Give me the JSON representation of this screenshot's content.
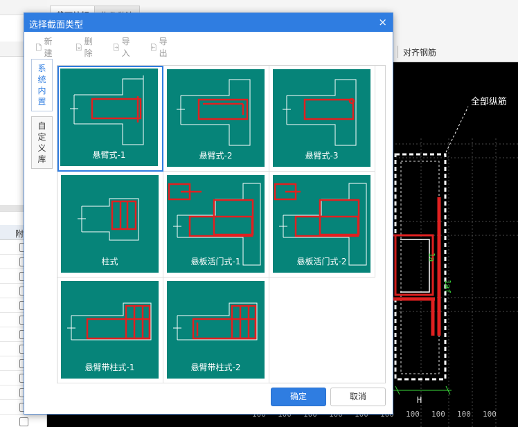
{
  "background": {
    "tabs": [
      "截面编辑",
      "构件做法"
    ],
    "toolbar_label": "对齐钢筋",
    "table_header": "附",
    "canvas": {
      "annotation": "全部纵筋",
      "dimension_label": "H",
      "scale_labels": [
        "100",
        "100",
        "100",
        "100",
        "100",
        "100",
        "100",
        "100",
        "100",
        "100"
      ]
    }
  },
  "dialog": {
    "title": "选择截面类型",
    "close_icon": "×",
    "toolbar": {
      "new": "新建",
      "delete": "删除",
      "import": "导入",
      "export": "导出"
    },
    "side_tabs": [
      {
        "chars": [
          "系",
          "统",
          "内",
          "置"
        ],
        "active": true
      },
      {
        "chars": [
          "自",
          "定",
          "义",
          "库"
        ],
        "active": false
      }
    ],
    "items": [
      {
        "label": "悬臂式-1",
        "selected": true
      },
      {
        "label": "悬臂式-2",
        "selected": false
      },
      {
        "label": "悬臂式-3",
        "selected": false
      },
      {
        "label": "柱式",
        "selected": false
      },
      {
        "label": "悬板活门式-1",
        "selected": false
      },
      {
        "label": "悬板活门式-2",
        "selected": false
      },
      {
        "label": "悬臂带柱式-1",
        "selected": false
      },
      {
        "label": "悬臂带柱式-2",
        "selected": false
      }
    ],
    "ok_label": "确定",
    "cancel_label": "取消"
  },
  "colors": {
    "titlebar": "#2f7de1",
    "thumb_bg": "#068479",
    "rebar": "#d42020"
  }
}
